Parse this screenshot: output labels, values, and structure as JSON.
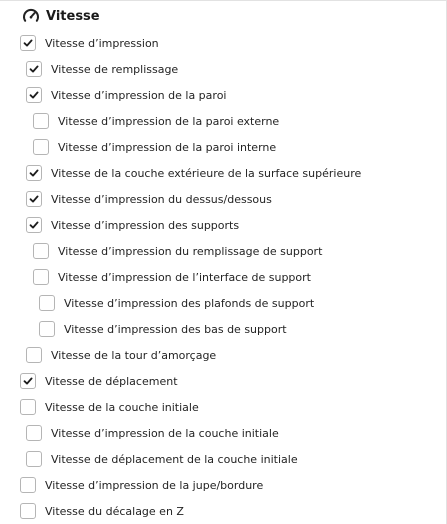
{
  "section": {
    "title": "Vitesse",
    "icon": "speedometer-icon"
  },
  "options": [
    {
      "label": "Vitesse d’impression",
      "checked": true
    },
    {
      "label": "Vitesse de remplissage",
      "checked": true
    },
    {
      "label": "Vitesse d’impression de la paroi",
      "checked": true
    },
    {
      "label": "Vitesse d’impression de la paroi externe",
      "checked": false
    },
    {
      "label": "Vitesse d’impression de la paroi interne",
      "checked": false
    },
    {
      "label": "Vitesse de la couche extérieure de la surface supérieure",
      "checked": true
    },
    {
      "label": "Vitesse d’impression du dessus/dessous",
      "checked": true
    },
    {
      "label": "Vitesse d’impression des supports",
      "checked": true
    },
    {
      "label": "Vitesse d’impression du remplissage de support",
      "checked": false
    },
    {
      "label": "Vitesse d’impression de l’interface de support",
      "checked": false
    },
    {
      "label": "Vitesse d’impression des plafonds de support",
      "checked": false
    },
    {
      "label": "Vitesse d’impression des bas de support",
      "checked": false
    },
    {
      "label": "Vitesse de la tour d’amorçage",
      "checked": false
    },
    {
      "label": "Vitesse de déplacement",
      "checked": true
    },
    {
      "label": "Vitesse de la couche initiale",
      "checked": false
    },
    {
      "label": "Vitesse d’impression de la couche initiale",
      "checked": false
    },
    {
      "label": "Vitesse de déplacement de la couche initiale",
      "checked": false
    },
    {
      "label": "Vitesse d’impression de la jupe/bordure",
      "checked": false
    },
    {
      "label": "Vitesse du décalage en Z",
      "checked": false
    }
  ]
}
